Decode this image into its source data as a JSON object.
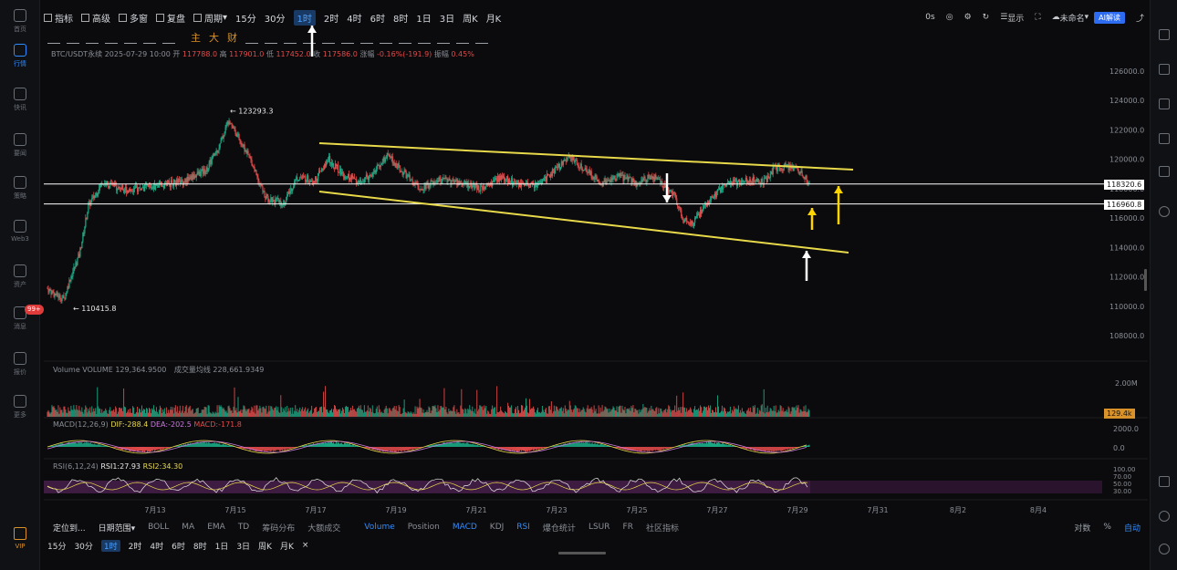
{
  "sidebar": {
    "items": [
      {
        "label": "首页",
        "icon": "home-icon"
      },
      {
        "label": "行情",
        "icon": "chart-icon"
      },
      {
        "label": "快讯",
        "icon": "news-icon"
      },
      {
        "label": "要闻",
        "icon": "article-icon"
      },
      {
        "label": "策略",
        "icon": "bot-icon"
      },
      {
        "label": "Web3",
        "icon": "web3-icon"
      },
      {
        "label": "资产",
        "icon": "wallet-icon"
      },
      {
        "label": "消息",
        "icon": "message-icon"
      },
      {
        "label": "报价",
        "icon": "quote-icon"
      },
      {
        "label": "更多",
        "icon": "more-icon"
      },
      {
        "label": "VIP",
        "icon": "vip-icon"
      }
    ],
    "badge": "99+"
  },
  "toolbar": {
    "left": [
      "指标",
      "高级",
      "多窗",
      "复盘",
      "周期"
    ],
    "periods": [
      "15分",
      "30分",
      "1时",
      "2时",
      "4时",
      "6时",
      "8时",
      "1日",
      "3日",
      "周K",
      "月K"
    ],
    "selected_period": "1时",
    "right": {
      "latency": "0s",
      "display": "显示",
      "account": "未命名",
      "ai": "AI解读"
    },
    "drawing_text": [
      "主",
      "大",
      "财"
    ]
  },
  "info_line": {
    "symbol": "BTC/USDT永续 2025-07-29 10:00",
    "open_label": "开",
    "open": "117788.0",
    "high_label": "高",
    "high": "117901.0",
    "low_label": "低",
    "low": "117452.0",
    "close_label": "收",
    "close": "117586.0",
    "change_label": "涨幅",
    "change": "-0.16%(-191.9)",
    "amp_label": "振幅",
    "amp": "0.45%"
  },
  "price_axis": [
    "126000.0",
    "124000.0",
    "122000.0",
    "120000.0",
    "118000.0",
    "116000.0",
    "114000.0",
    "112000.0",
    "110000.0",
    "108000.0"
  ],
  "price_tags": {
    "level1": "118320.6",
    "level2": "116960.8"
  },
  "annotations": {
    "high": "123293.3",
    "low": "110415.8"
  },
  "volume": {
    "label": "Volume VOLUME 129,364.9500",
    "ma_label": "成交量均线 228,661.9349",
    "axis": "2.00M",
    "tag": "129.4k"
  },
  "macd": {
    "label": "MACD(12,26,9)",
    "dif": "DIF:-288.4",
    "dea": "DEA:-202.5",
    "macd": "MACD:-171.8",
    "axis": [
      "2000.0",
      "0.0"
    ]
  },
  "rsi": {
    "label": "RSI(6,12,24)",
    "rsi1": "RSI1:27.93",
    "rsi2": "RSI2:34.30",
    "axis": [
      "100.00",
      "70.00",
      "50.00",
      "30.00"
    ]
  },
  "x_axis": [
    "7月13",
    "7月15",
    "7月17",
    "7月19",
    "7月21",
    "7月23",
    "7月25",
    "7月27",
    "7月29",
    "7月31",
    "8月2",
    "8月4"
  ],
  "bottom_bar": {
    "left": [
      "定位到...",
      "日期范围"
    ],
    "indicators": [
      "BOLL",
      "MA",
      "EMA",
      "TD",
      "筹码分布",
      "大额成交",
      "Volume",
      "Position",
      "MACD",
      "KDJ",
      "RSI",
      "爆仓统计",
      "LSUR",
      "FR",
      "社区指标"
    ],
    "active": [
      "Volume",
      "MACD",
      "RSI"
    ],
    "right": [
      "对数",
      "%",
      "自动"
    ]
  },
  "bottom_periods": [
    "15分",
    "30分",
    "1时",
    "2时",
    "4时",
    "6时",
    "8时",
    "1日",
    "3日",
    "周K",
    "月K",
    "×"
  ],
  "colors": {
    "up": "#1aa985",
    "down": "#e04a4a",
    "trendline": "#e8d94a",
    "accent": "#2f8cff",
    "level": "#ffffff",
    "volume_tag": "#d9922a"
  }
}
